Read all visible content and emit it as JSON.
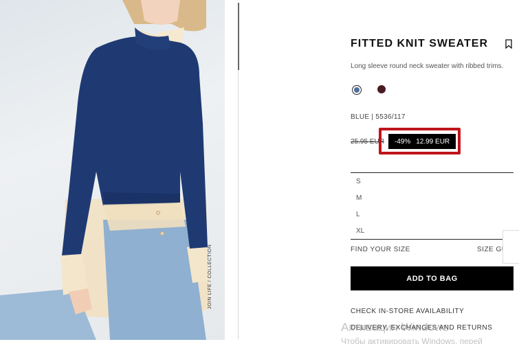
{
  "product": {
    "title": "FITTED KNIT SWEATER",
    "description": "Long sleeve round neck sweater with ribbed trims.",
    "color_code": "BLUE | 5536/117",
    "old_price": "25.95 EUR",
    "discount": "-49%",
    "price": "12.99 EUR",
    "photo_caption": "JOIN LIFE / COLLECTION"
  },
  "colors": {
    "swatch_1": "#3a5a8c",
    "swatch_2": "#4a1a22",
    "highlight": "#c0141b"
  },
  "sizes": [
    "S",
    "M",
    "L",
    "XL"
  ],
  "actions": {
    "find_your_size": "FIND YOUR SIZE",
    "size_guide": "SIZE GU",
    "add_to_bag": "ADD TO BAG",
    "check_store": "CHECK IN-STORE AVAILABILITY",
    "delivery": "DELIVERY, EXCHANGES AND RETURNS"
  },
  "icons": {
    "bookmark": "bookmark-icon"
  },
  "watermark": {
    "line1": "Активация Windows",
    "line2": "Чтобы активировать Windows, перей"
  }
}
